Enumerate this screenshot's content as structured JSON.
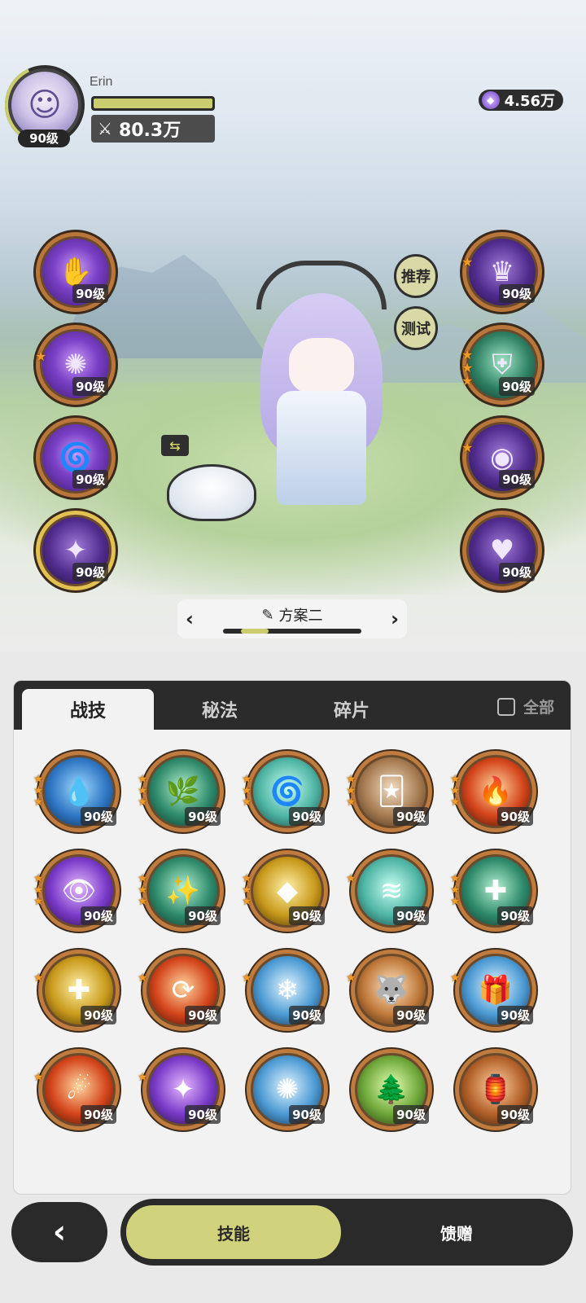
{
  "player": {
    "name": "Erin",
    "level": "90级",
    "hp_fraction": 1.0,
    "power": "80.3万"
  },
  "currency": {
    "icon": "crystal-icon",
    "amount": "4.56万"
  },
  "left_slots": [
    {
      "level": "90级",
      "stars": 0,
      "icon": "claw-hand-icon"
    },
    {
      "level": "90级",
      "stars": 1,
      "icon": "starburst-icon"
    },
    {
      "level": "90级",
      "stars": 0,
      "icon": "vortex-icon"
    },
    {
      "level": "90级",
      "stars": 0,
      "icon": "sparkle-icon"
    }
  ],
  "right_slots": [
    {
      "level": "90级",
      "stars": 1,
      "icon": "crown-eye-icon"
    },
    {
      "level": "90级",
      "stars": 3,
      "icon": "shield-icon"
    },
    {
      "level": "90级",
      "stars": 1,
      "icon": "mask-eye-icon"
    },
    {
      "level": "90级",
      "stars": 0,
      "icon": "heart-orb-icon"
    }
  ],
  "side_buttons": {
    "recommend": "推荐",
    "test": "测试"
  },
  "preset": {
    "label": "方案二",
    "edit_icon": "pencil-icon"
  },
  "tabs": [
    {
      "label": "战技",
      "active": true
    },
    {
      "label": "秘法",
      "active": false
    },
    {
      "label": "碎片",
      "active": false
    }
  ],
  "all_toggle": {
    "label": "全部",
    "checked": false
  },
  "skills": [
    {
      "level": "90级",
      "stars": 3,
      "theme": "blue",
      "glyph": "💧"
    },
    {
      "level": "90级",
      "stars": 3,
      "theme": "green",
      "glyph": "🌿"
    },
    {
      "level": "90级",
      "stars": 3,
      "theme": "teal",
      "glyph": "🌀"
    },
    {
      "level": "90级",
      "stars": 3,
      "theme": "tan",
      "glyph": "🃏"
    },
    {
      "level": "90级",
      "stars": 3,
      "theme": "fire",
      "glyph": "🔥"
    },
    {
      "level": "90级",
      "stars": 3,
      "theme": "violet",
      "glyph": "👁"
    },
    {
      "level": "90级",
      "stars": 3,
      "theme": "green",
      "glyph": "✨"
    },
    {
      "level": "90级",
      "stars": 3,
      "theme": "gold",
      "glyph": "◆"
    },
    {
      "level": "90级",
      "stars": 1,
      "theme": "teal",
      "glyph": "≋"
    },
    {
      "level": "90级",
      "stars": 3,
      "theme": "green",
      "glyph": "✚"
    },
    {
      "level": "90级",
      "stars": 1,
      "theme": "gold",
      "glyph": "✚"
    },
    {
      "level": "90级",
      "stars": 1,
      "theme": "fire",
      "glyph": "⟳"
    },
    {
      "level": "90级",
      "stars": 1,
      "theme": "ice",
      "glyph": "❄"
    },
    {
      "level": "90级",
      "stars": 1,
      "theme": "beige",
      "glyph": "🐺"
    },
    {
      "level": "90级",
      "stars": 1,
      "theme": "ice",
      "glyph": "🎁"
    },
    {
      "level": "90级",
      "stars": 1,
      "theme": "fire",
      "glyph": "☄"
    },
    {
      "level": "90级",
      "stars": 1,
      "theme": "violet",
      "glyph": "✦"
    },
    {
      "level": "90级",
      "stars": 0,
      "theme": "ice",
      "glyph": "✺"
    },
    {
      "level": "90级",
      "stars": 0,
      "theme": "leaf",
      "glyph": "🌲"
    },
    {
      "level": "90级",
      "stars": 0,
      "theme": "brown",
      "glyph": "🏮"
    }
  ],
  "bottom": {
    "back_icon": "chevron-left-icon",
    "skills_label": "技能",
    "gift_label": "馈赠"
  },
  "colors": {
    "accent": "#c9cd6d",
    "dark": "#2a2a2a",
    "star": "#f09a27",
    "ring": "#c07b3e"
  }
}
